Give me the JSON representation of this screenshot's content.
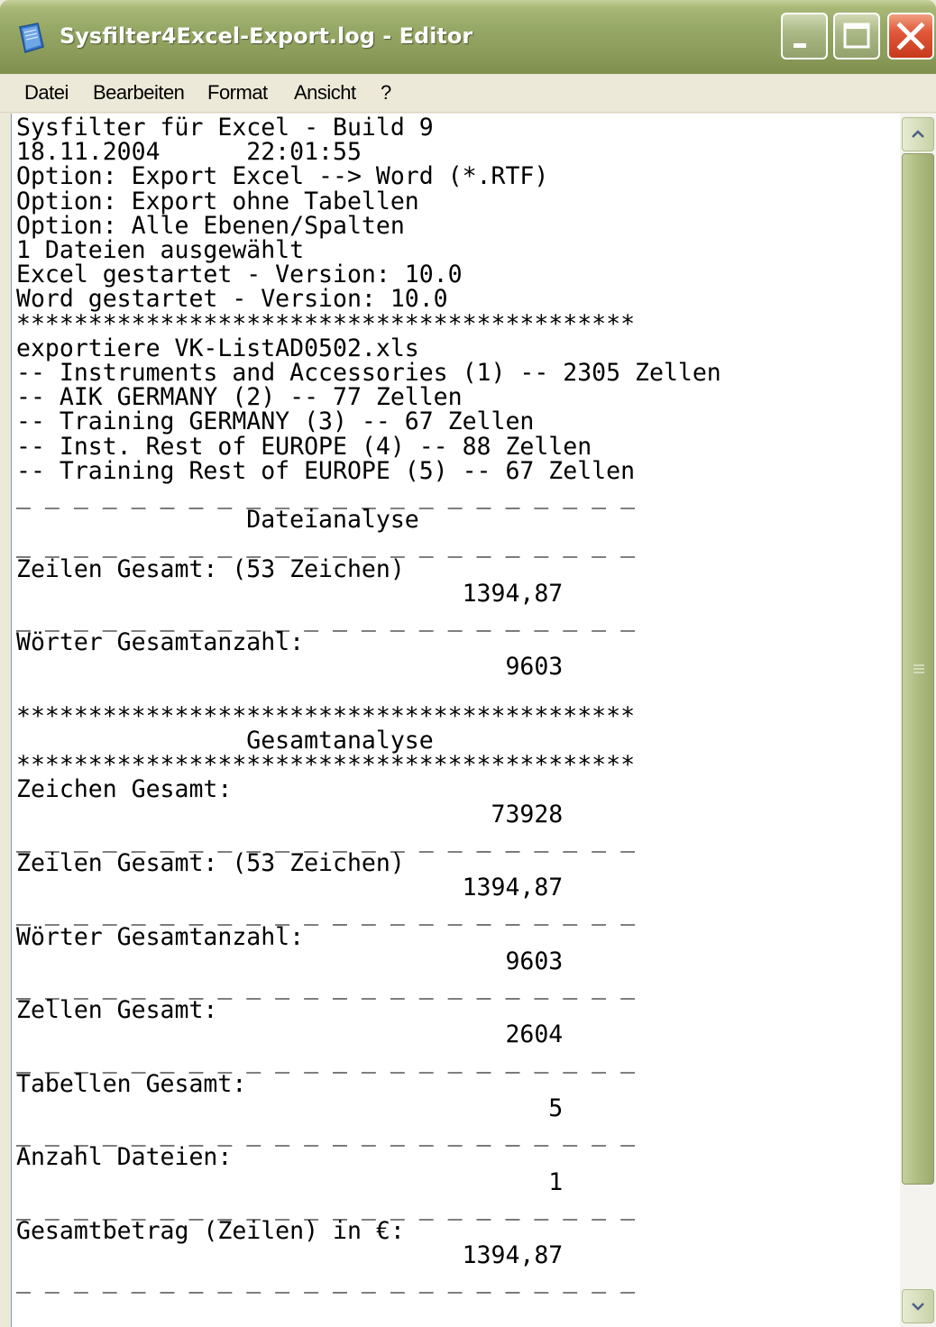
{
  "window": {
    "title": "Sysfilter4Excel-Export.log - Editor"
  },
  "menu": {
    "items": [
      "Datei",
      "Bearbeiten",
      "Format",
      "Ansicht",
      "?"
    ]
  },
  "editor": {
    "lines": [
      "Sysfilter für Excel - Build 9",
      "18.11.2004      22:01:55",
      "Option: Export Excel --> Word (*.RTF)",
      "Option: Export ohne Tabellen",
      "Option: Alle Ebenen/Spalten",
      "1 Dateien ausgewählt",
      "Excel gestartet - Version: 10.0",
      "Word gestartet - Version: 10.0",
      "*******************************************",
      "exportiere VK-ListAD0502.xls",
      "-- Instruments and Accessories (1) -- 2305 Zellen",
      "-- AIK GERMANY (2) -- 77 Zellen",
      "-- Training GERMANY (3) -- 67 Zellen",
      "-- Inst. Rest of EUROPE (4) -- 88 Zellen",
      "-- Training Rest of EUROPE (5) -- 67 Zellen",
      "_ _ _ _ _ _ _ _ _ _ _ _ _ _ _ _ _ _ _ _ _ _",
      "                Dateianalyse",
      "_ _ _ _ _ _ _ _ _ _ _ _ _ _ _ _ _ _ _ _ _ _",
      "Zeilen Gesamt: (53 Zeichen)",
      "                               1394,87",
      "_ _ _ _ _ _ _ _ _ _ _ _ _ _ _ _ _ _ _ _ _ _",
      "Wörter Gesamtanzahl:",
      "                                  9603",
      "",
      "*******************************************",
      "                Gesamtanalyse",
      "*******************************************",
      "Zeichen Gesamt:",
      "                                 73928",
      "_ _ _ _ _ _ _ _ _ _ _ _ _ _ _ _ _ _ _ _ _ _",
      "Zeilen Gesamt: (53 Zeichen)",
      "                               1394,87",
      "_ _ _ _ _ _ _ _ _ _ _ _ _ _ _ _ _ _ _ _ _ _",
      "Wörter Gesamtanzahl:",
      "                                  9603",
      "_ _ _ _ _ _ _ _ _ _ _ _ _ _ _ _ _ _ _ _ _ _",
      "Zellen Gesamt:",
      "                                  2604",
      "_ _ _ _ _ _ _ _ _ _ _ _ _ _ _ _ _ _ _ _ _ _",
      "Tabellen Gesamt:",
      "                                     5",
      "_ _ _ _ _ _ _ _ _ _ _ _ _ _ _ _ _ _ _ _ _ _",
      "Anzahl Dateien:",
      "                                     1",
      "_ _ _ _ _ _ _ _ _ _ _ _ _ _ _ _ _ _ _ _ _ _",
      "Gesamtbetrag (Zeilen) in €:",
      "                               1394,87",
      "_ _ _ _ _ _ _ _ _ _ _ _ _ _ _ _ _ _ _ _ _ _"
    ]
  },
  "icons": {
    "app": "notepad-icon",
    "minimize": "minimize-icon",
    "maximize": "maximize-icon",
    "close": "close-icon",
    "scroll_up": "chevron-up-icon",
    "scroll_down": "chevron-down-icon"
  }
}
